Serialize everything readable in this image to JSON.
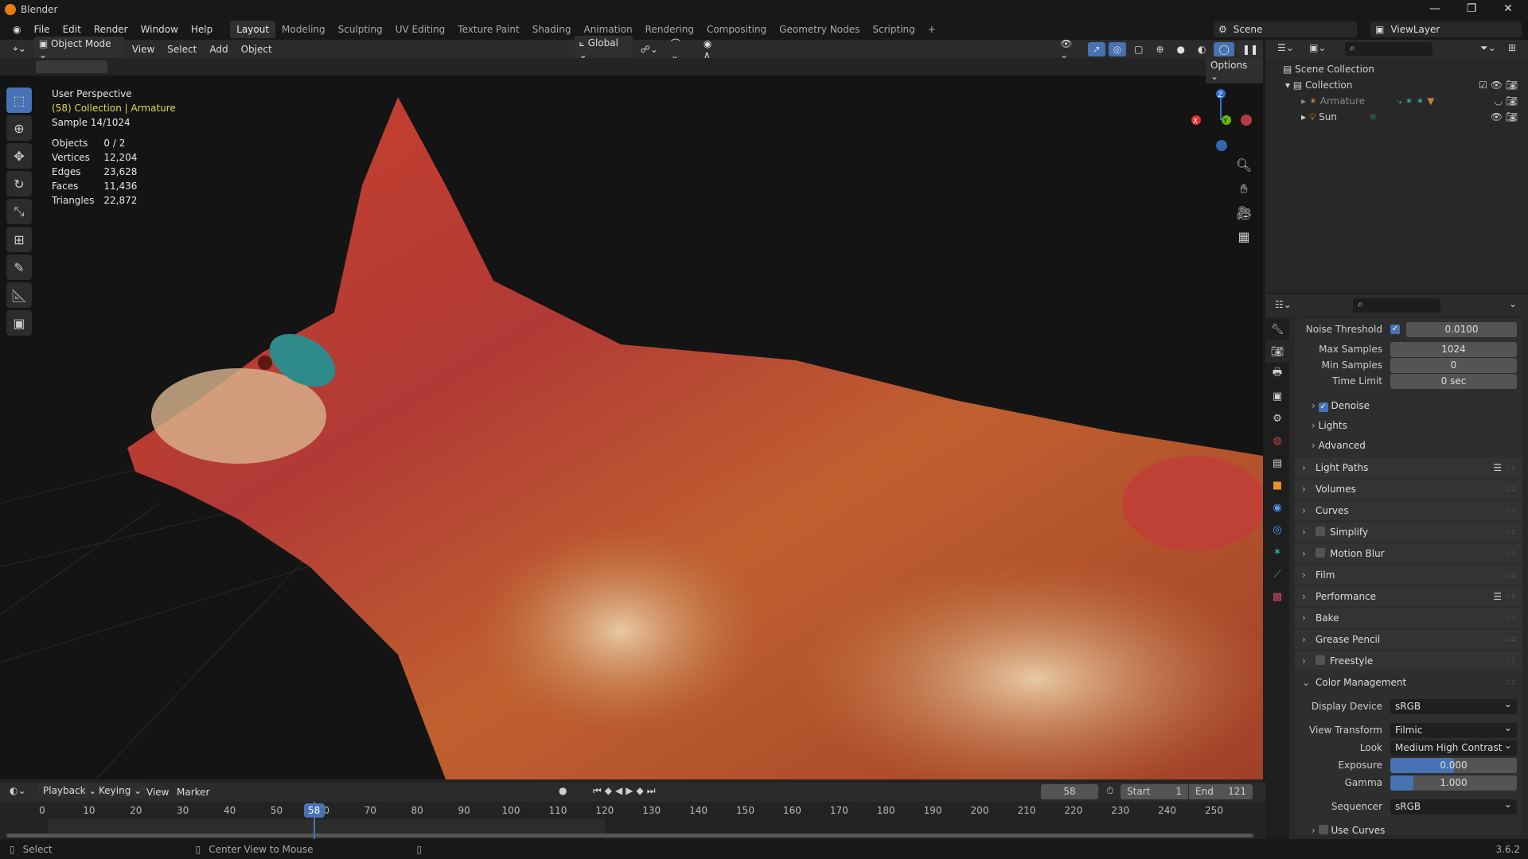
{
  "title_bar": {
    "app_title": "Blender"
  },
  "menu": [
    "File",
    "Edit",
    "Render",
    "Window",
    "Help"
  ],
  "workspaces": [
    "Layout",
    "Modeling",
    "Sculpting",
    "UV Editing",
    "Texture Paint",
    "Shading",
    "Animation",
    "Rendering",
    "Compositing",
    "Geometry Nodes",
    "Scripting",
    "+"
  ],
  "active_workspace": "Layout",
  "scene": {
    "scene": "Scene",
    "view_layer": "ViewLayer"
  },
  "viewport_header": {
    "mode": "Object Mode",
    "menus": [
      "View",
      "Select",
      "Add",
      "Object"
    ],
    "orientation": "Global",
    "options": "Options"
  },
  "overlay": {
    "view": "User Perspective",
    "object": "(58) Collection | Armature",
    "sample": "Sample 14/1024",
    "stats": [
      {
        "label": "Objects",
        "value": "0 / 2"
      },
      {
        "label": "Vertices",
        "value": "12,204"
      },
      {
        "label": "Edges",
        "value": "23,628"
      },
      {
        "label": "Faces",
        "value": "11,436"
      },
      {
        "label": "Triangles",
        "value": "22,872"
      }
    ]
  },
  "gizmo": {
    "x": "X",
    "y": "Y",
    "z": "Z"
  },
  "outliner": {
    "root": "Scene Collection",
    "collection": "Collection",
    "items": [
      "Armature",
      "Sun"
    ]
  },
  "properties": {
    "sampling": [
      {
        "label": "Noise Threshold",
        "value": "0.0100",
        "checked": true
      },
      {
        "label": "Max Samples",
        "value": "1024"
      },
      {
        "label": "Min Samples",
        "value": "0"
      },
      {
        "label": "Time Limit",
        "value": "0 sec"
      }
    ],
    "subpanels": [
      {
        "label": "Denoise",
        "checked": true
      },
      {
        "label": "Lights"
      },
      {
        "label": "Advanced"
      }
    ],
    "panels": [
      {
        "label": "Light Paths",
        "list": true
      },
      {
        "label": "Volumes"
      },
      {
        "label": "Curves"
      },
      {
        "label": "Simplify",
        "checkbox": true
      },
      {
        "label": "Motion Blur",
        "checkbox": true
      },
      {
        "label": "Film"
      },
      {
        "label": "Performance",
        "list": true
      },
      {
        "label": "Bake"
      },
      {
        "label": "Grease Pencil"
      },
      {
        "label": "Freestyle",
        "checkbox": true
      },
      {
        "label": "Color Management",
        "open": true
      }
    ],
    "color_management": {
      "display_device_label": "Display Device",
      "display_device": "sRGB",
      "view_transform_label": "View Transform",
      "view_transform": "Filmic",
      "look_label": "Look",
      "look": "Medium High Contrast",
      "exposure_label": "Exposure",
      "exposure": "0.000",
      "exposure_fill": 0.5,
      "gamma_label": "Gamma",
      "gamma": "1.000",
      "gamma_fill": 0.18,
      "sequencer_label": "Sequencer",
      "sequencer": "sRGB",
      "use_curves": "Use Curves"
    }
  },
  "timeline": {
    "menus": [
      "Playback",
      "Keying",
      "View",
      "Marker"
    ],
    "current_frame": "58",
    "start_label": "Start",
    "start": "1",
    "end_label": "End",
    "end": "121",
    "ticks": [
      "0",
      "10",
      "20",
      "30",
      "40",
      "50",
      "60",
      "70",
      "80",
      "90",
      "100",
      "110",
      "120",
      "130",
      "140",
      "150",
      "160",
      "170",
      "180",
      "190",
      "200",
      "210",
      "220",
      "230",
      "240",
      "250"
    ]
  },
  "status": {
    "left": "Select",
    "middle": "Center View to Mouse",
    "version": "3.6.2"
  },
  "colors": {
    "accent": "#4772b3",
    "highlight": "#e5d84a"
  }
}
